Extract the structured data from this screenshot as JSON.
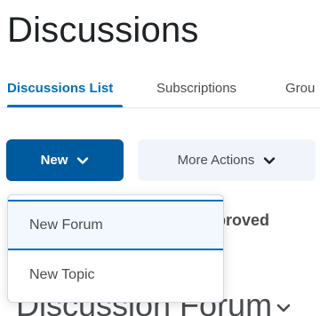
{
  "page": {
    "title": "Discussions"
  },
  "tabs": [
    {
      "label": "Discussions List",
      "active": true
    },
    {
      "label": "Subscriptions",
      "active": false
    },
    {
      "label": "Grou",
      "active": false
    }
  ],
  "toolbar": {
    "new_label": "New",
    "more_actions_label": "More Actions"
  },
  "dropdown": {
    "items": [
      {
        "label": "New Forum"
      },
      {
        "label": "New Topic"
      }
    ]
  },
  "background": {
    "approved_fragment": "pproved",
    "forum_fragment": "Discussion Forum"
  },
  "colors": {
    "accent": "#006fbf",
    "primary_button": "#005a9e",
    "secondary_button": "#f1f5fb"
  },
  "icons": {
    "new_chevron": "chevron-down-icon",
    "more_chevron": "chevron-down-icon",
    "forum_chevron": "chevron-down-icon"
  }
}
